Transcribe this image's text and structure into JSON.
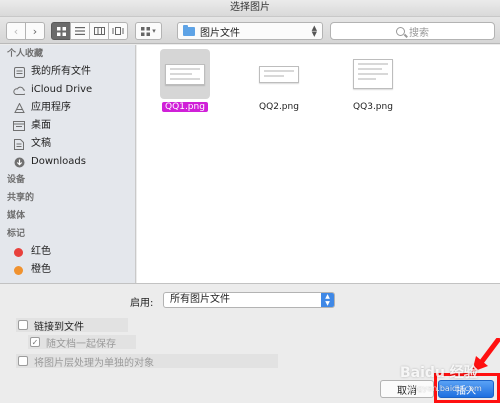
{
  "window": {
    "title": "选择图片"
  },
  "toolbar": {
    "path_label": "图片文件",
    "search_placeholder": "搜索"
  },
  "sidebar": {
    "sections": [
      {
        "header": "个人收藏",
        "items": [
          {
            "label": "我的所有文件",
            "icon": "all-files-icon"
          },
          {
            "label": "iCloud Drive",
            "icon": "cloud-icon"
          },
          {
            "label": "应用程序",
            "icon": "applications-icon"
          },
          {
            "label": "桌面",
            "icon": "desktop-icon"
          },
          {
            "label": "文稿",
            "icon": "documents-icon"
          },
          {
            "label": "Downloads",
            "icon": "downloads-icon"
          }
        ]
      },
      {
        "header": "设备",
        "items": []
      },
      {
        "header": "共享的",
        "items": []
      },
      {
        "header": "媒体",
        "items": []
      },
      {
        "header": "标记",
        "items": [
          {
            "label": "红色",
            "color": "#e8413c"
          },
          {
            "label": "橙色",
            "color": "#f0922f"
          }
        ]
      }
    ]
  },
  "files": [
    {
      "name": "QQ1.png",
      "selected": true
    },
    {
      "name": "QQ2.png",
      "selected": false
    },
    {
      "name": "QQ3.png",
      "selected": false
    }
  ],
  "options": {
    "enable_label": "启用:",
    "filter_value": "所有图片文件",
    "link_to_file": "链接到文件",
    "save_with_document": "随文档一起保存",
    "treat_as_single_object": "将图片层处理为单独的对象"
  },
  "buttons": {
    "cancel": "取消",
    "insert": "插入"
  },
  "watermark": {
    "text": "Baidu 经验",
    "sub": "jingyan.baidu.com"
  }
}
